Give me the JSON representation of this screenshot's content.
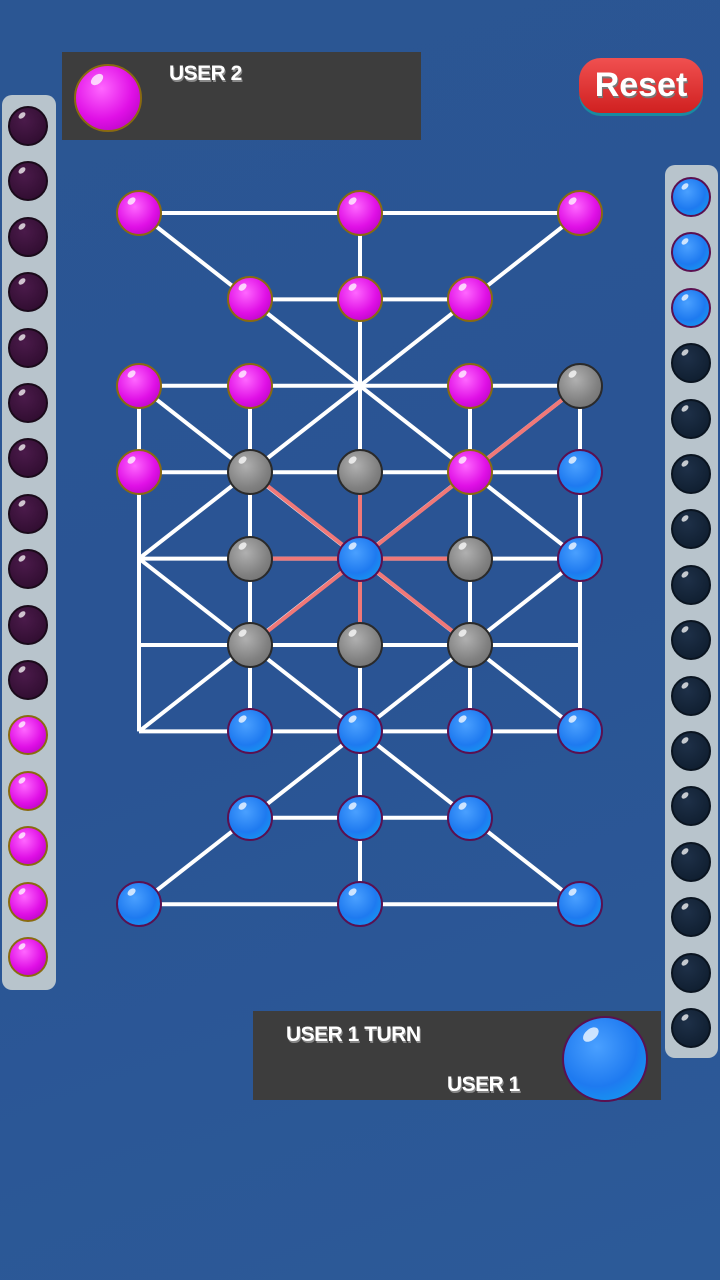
{
  "top_panel": {
    "player": "USER 2",
    "piece_color": "pink"
  },
  "reset_label": "Reset",
  "bottom_panel": {
    "turn_text": "USER 1 TURN",
    "player": "USER 1",
    "piece_color": "blue"
  },
  "left_tray": [
    "dpurple",
    "dpurple",
    "dpurple",
    "dpurple",
    "dpurple",
    "dpurple",
    "dpurple",
    "dpurple",
    "dpurple",
    "dpurple",
    "dpurple",
    "pink",
    "pink",
    "pink",
    "pink",
    "pink"
  ],
  "right_tray": [
    "blue",
    "blue",
    "blue",
    "dnavy",
    "dnavy",
    "dnavy",
    "dnavy",
    "dnavy",
    "dnavy",
    "dnavy",
    "dnavy",
    "dnavy",
    "dnavy",
    "dnavy",
    "dnavy",
    "dnavy"
  ],
  "board": [
    [
      "P",
      null,
      "P",
      null,
      "P"
    ],
    [
      null,
      "P",
      "P",
      "P",
      null
    ],
    [
      "P",
      "P",
      "",
      "P",
      "G"
    ],
    [
      "P",
      "G",
      "G",
      "P",
      "B"
    ],
    [
      "",
      "G",
      "B",
      "G",
      "B"
    ],
    [
      "",
      "G",
      "G",
      "G",
      ""
    ],
    [
      "",
      "B",
      "B",
      "B",
      "B"
    ],
    [
      null,
      "B",
      "B",
      "B",
      null
    ],
    [
      "B",
      null,
      "B",
      null,
      "B"
    ]
  ],
  "selected": [
    4,
    2
  ],
  "highlighted_moves": [
    [
      3,
      1
    ],
    [
      3,
      2
    ],
    [
      2,
      4
    ],
    [
      4,
      1
    ],
    [
      4,
      3
    ],
    [
      5,
      1
    ],
    [
      5,
      2
    ],
    [
      5,
      3
    ]
  ],
  "colors": {
    "pink": "#e010e6",
    "blue": "#1e7af0",
    "gray": "#808080",
    "line": "#ffffff",
    "highlight": "#f07878",
    "background": "#2b5693",
    "reset": "#e03030"
  }
}
